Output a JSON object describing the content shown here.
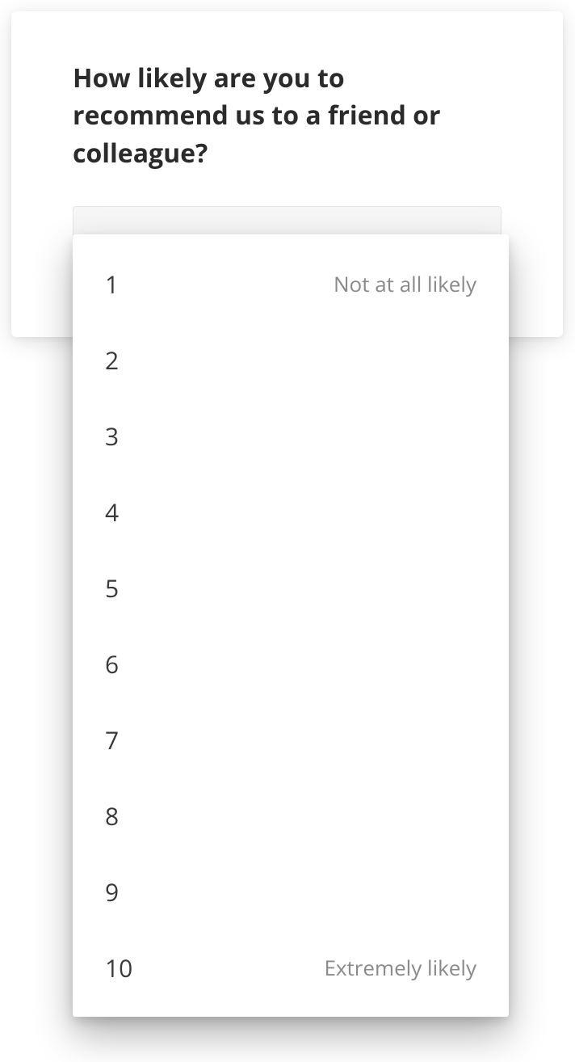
{
  "question": "How likely are you to recommend us to a friend or colleague?",
  "select": {
    "selected": ""
  },
  "options": [
    {
      "value": "1",
      "hint": "Not at all likely"
    },
    {
      "value": "2",
      "hint": ""
    },
    {
      "value": "3",
      "hint": ""
    },
    {
      "value": "4",
      "hint": ""
    },
    {
      "value": "5",
      "hint": ""
    },
    {
      "value": "6",
      "hint": ""
    },
    {
      "value": "7",
      "hint": ""
    },
    {
      "value": "8",
      "hint": ""
    },
    {
      "value": "9",
      "hint": ""
    },
    {
      "value": "10",
      "hint": "Extremely likely"
    }
  ]
}
